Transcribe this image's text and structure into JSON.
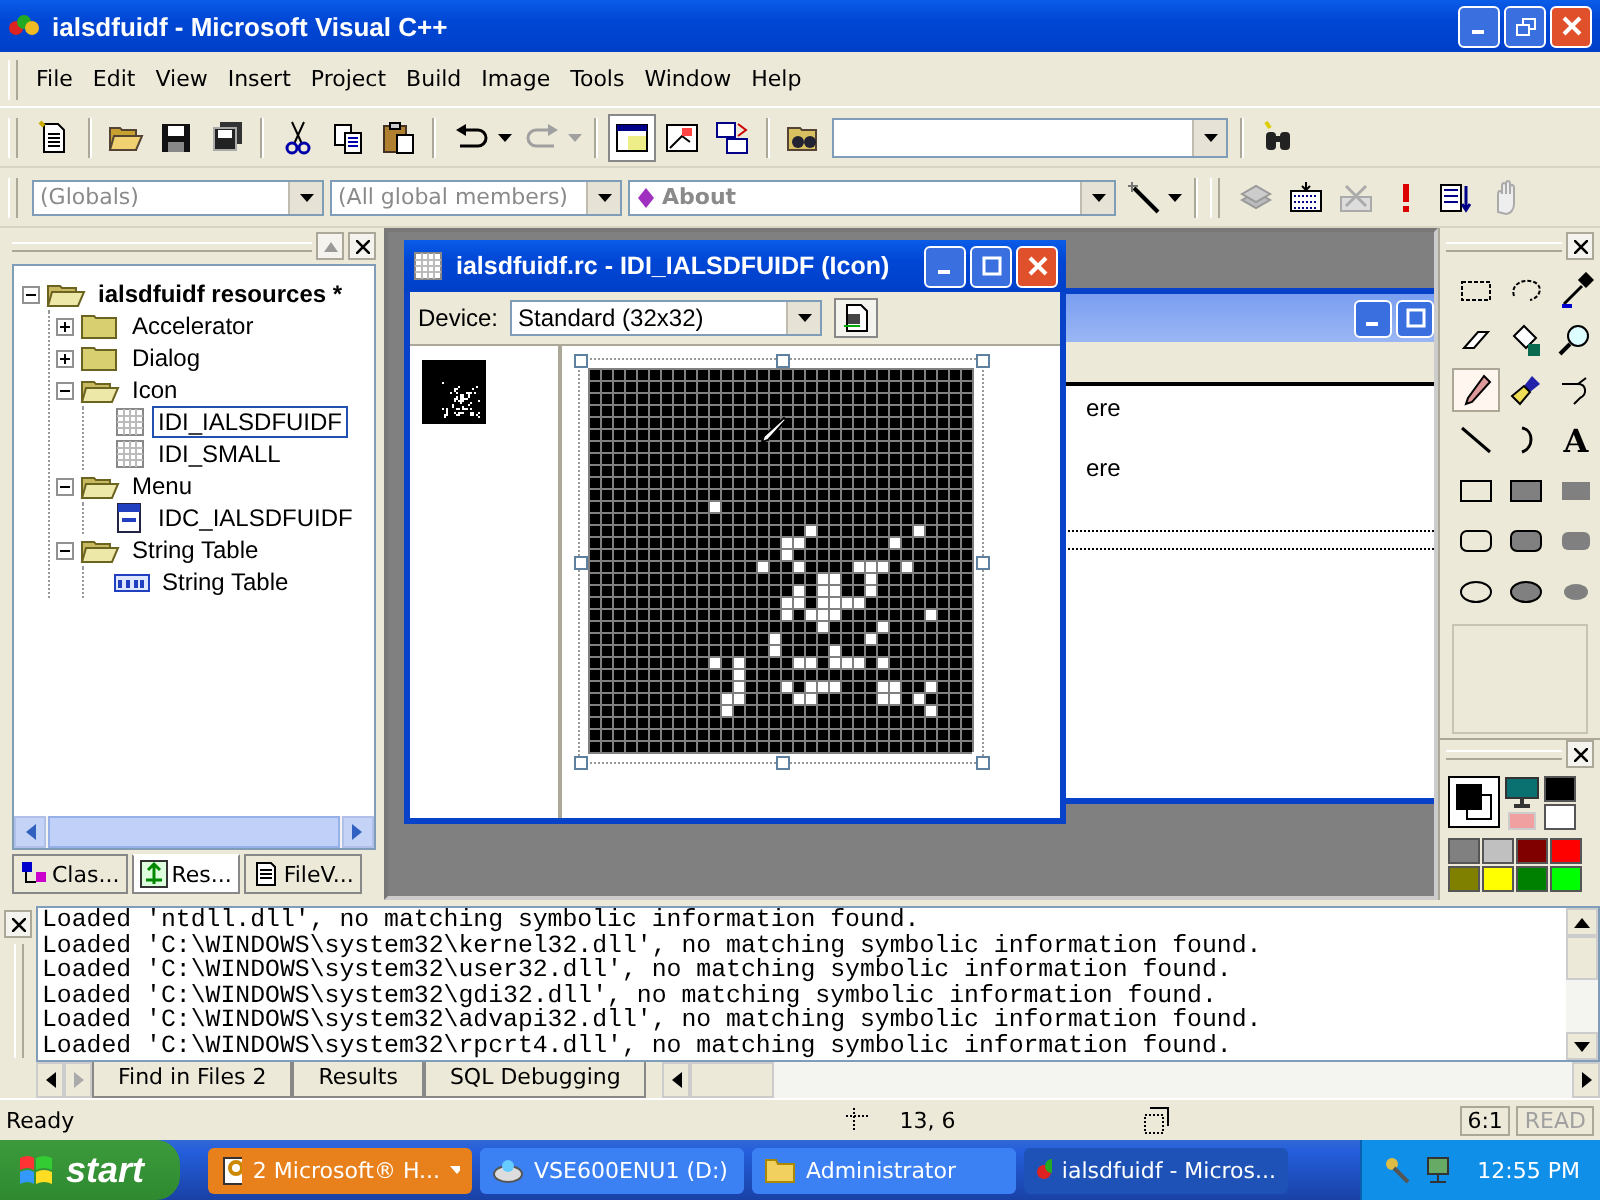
{
  "window": {
    "title": "ialsdfuidf - Microsoft Visual C++"
  },
  "menu": [
    "File",
    "Edit",
    "View",
    "Insert",
    "Project",
    "Build",
    "Image",
    "Tools",
    "Window",
    "Help"
  ],
  "wizard_bar": {
    "class_combo": {
      "value": "(Globals)",
      "disabled": true
    },
    "members_combo": {
      "value": "(All global members)",
      "disabled": true
    },
    "function_combo": {
      "value": "About",
      "disabled": true
    }
  },
  "workspace": {
    "tree": [
      {
        "label": "ialsdfuidf resources *",
        "kind": "root",
        "expanded": true,
        "selected": false,
        "children": [
          {
            "label": "Accelerator",
            "kind": "folder",
            "expanded": false,
            "selected": false
          },
          {
            "label": "Dialog",
            "kind": "folder",
            "expanded": false,
            "selected": false
          },
          {
            "label": "Icon",
            "kind": "folder",
            "expanded": true,
            "selected": false,
            "children": [
              {
                "label": "IDI_IALSDFUIDF",
                "kind": "icon",
                "selected": true
              },
              {
                "label": "IDI_SMALL",
                "kind": "icon",
                "selected": false
              }
            ]
          },
          {
            "label": "Menu",
            "kind": "folder",
            "expanded": true,
            "selected": false,
            "children": [
              {
                "label": "IDC_IALSDFUIDF",
                "kind": "menu",
                "selected": false
              }
            ]
          },
          {
            "label": "String Table",
            "kind": "folder",
            "expanded": true,
            "selected": false,
            "children": [
              {
                "label": "String Table",
                "kind": "strings",
                "selected": false
              }
            ]
          }
        ]
      }
    ],
    "tabs": [
      {
        "label": "Clas...",
        "kind": "classes",
        "selected": false
      },
      {
        "label": "Res...",
        "kind": "resources",
        "selected": true
      },
      {
        "label": "FileV...",
        "kind": "files",
        "selected": false
      }
    ]
  },
  "back_window": {
    "lines": [
      "ere",
      "ere"
    ]
  },
  "icon_editor": {
    "title": "ialsdfuidf.rc - IDI_IALSDFUIDF (Icon)",
    "device_label": "Device:",
    "device_value": "Standard (32x32)"
  },
  "toolbox": {
    "tools": [
      {
        "kind": "rect-select",
        "selected": false
      },
      {
        "kind": "free-select",
        "selected": false
      },
      {
        "kind": "picker",
        "selected": false
      },
      {
        "kind": "eraser",
        "selected": false
      },
      {
        "kind": "fill",
        "selected": false
      },
      {
        "kind": "magnifier",
        "selected": false
      },
      {
        "kind": "pencil",
        "selected": true
      },
      {
        "kind": "brush",
        "selected": false
      },
      {
        "kind": "airbrush",
        "selected": false
      },
      {
        "kind": "line",
        "selected": false
      },
      {
        "kind": "curve",
        "selected": false
      },
      {
        "kind": "text",
        "glyph": "A",
        "selected": false
      },
      {
        "kind": "rect",
        "selected": false
      },
      {
        "kind": "rect-fill-outline",
        "selected": false
      },
      {
        "kind": "rect-fill",
        "selected": false
      },
      {
        "kind": "round",
        "selected": false
      },
      {
        "kind": "round-fill-outline",
        "selected": false
      },
      {
        "kind": "round-fill",
        "selected": false
      },
      {
        "kind": "ellipse",
        "selected": false
      },
      {
        "kind": "ellipse-fill-outline",
        "selected": false
      },
      {
        "kind": "ellipse-fill",
        "selected": false
      }
    ]
  },
  "colors": {
    "swatches": [
      {
        "color": "#808080"
      },
      {
        "color": "#c0c0c0"
      },
      {
        "color": "#800000"
      },
      {
        "color": "#ff0000"
      },
      {
        "color": "#808000"
      },
      {
        "color": "#ffff00"
      },
      {
        "color": "#008000"
      },
      {
        "color": "#00ff00"
      }
    ]
  },
  "output": {
    "lines": [
      "Loaded 'ntdll.dll', no matching symbolic information found.",
      "Loaded 'C:\\WINDOWS\\system32\\kernel32.dll', no matching symbolic information found.",
      "Loaded 'C:\\WINDOWS\\system32\\user32.dll', no matching symbolic information found.",
      "Loaded 'C:\\WINDOWS\\system32\\gdi32.dll', no matching symbolic information found.",
      "Loaded 'C:\\WINDOWS\\system32\\advapi32.dll', no matching symbolic information found.",
      "Loaded 'C:\\WINDOWS\\system32\\rpcrt4.dll', no matching symbolic information found."
    ],
    "tabs": [
      {
        "label": "Find in Files 2",
        "selected": false
      },
      {
        "label": "Results",
        "selected": false
      },
      {
        "label": "SQL Debugging",
        "selected": false
      }
    ]
  },
  "status_bar": {
    "text": "Ready",
    "position": "13, 6",
    "zoom": "6:1",
    "mode": {
      "label": "READ",
      "disabled": true
    }
  },
  "taskbar": {
    "start": "start",
    "buttons": [
      {
        "label": "2 Microsoft® H...",
        "kind": "help",
        "flashing": true,
        "selected": false
      },
      {
        "label": "VSE600ENU1 (D:)",
        "kind": "drive",
        "flashing": false,
        "selected": false
      },
      {
        "label": "Administrator",
        "kind": "folder",
        "flashing": false,
        "selected": false
      },
      {
        "label": "ialsdfuidf - Micros...",
        "kind": "app",
        "flashing": false,
        "selected": true
      }
    ],
    "clock": "12:55 PM"
  }
}
